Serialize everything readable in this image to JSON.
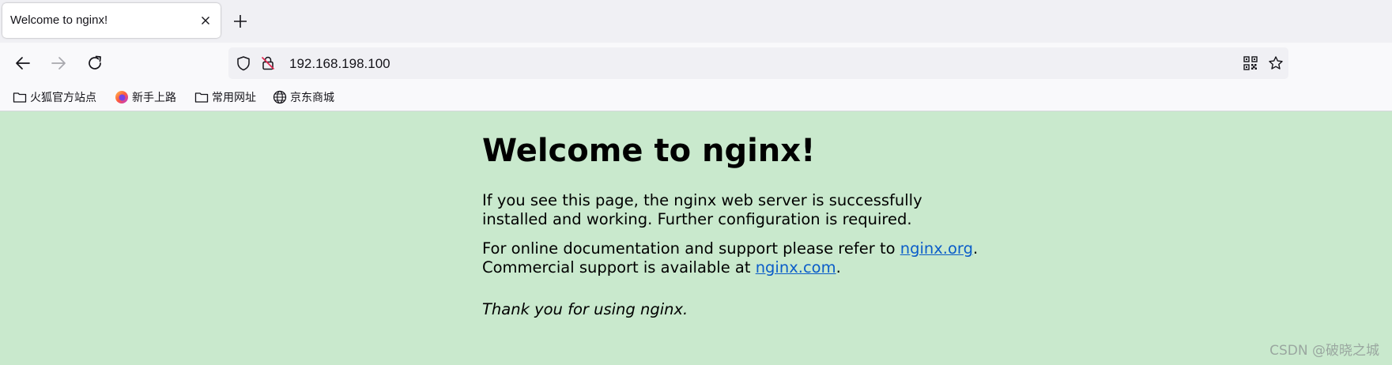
{
  "tab": {
    "title": "Welcome to nginx!",
    "close_icon": "close-icon",
    "new_tab_icon": "plus-icon"
  },
  "toolbar": {
    "back_icon": "arrow-left-icon",
    "forward_icon": "arrow-right-icon",
    "reload_icon": "reload-icon",
    "url": "192.168.198.100",
    "security_icon": "shield-icon",
    "insecure_icon": "insecure-lock-icon",
    "qr_icon": "qr-code-icon",
    "bookmark_star_icon": "star-icon"
  },
  "bookmarks": [
    {
      "label": "火狐官方站点",
      "icon": "folder-icon"
    },
    {
      "label": "新手上路",
      "icon": "firefox-icon"
    },
    {
      "label": "常用网址",
      "icon": "folder-icon"
    },
    {
      "label": "京东商城",
      "icon": "globe-icon"
    }
  ],
  "content": {
    "heading": "Welcome to nginx!",
    "para1": "If you see this page, the nginx web server is successfully installed and working. Further configuration is required.",
    "para2_prefix": "For online documentation and support please refer to ",
    "link1": "nginx.org",
    "para2_mid": ".",
    "para2_line2": "Commercial support is available at ",
    "link2": "nginx.com",
    "para2_end": ".",
    "para3": "Thank you for using nginx."
  },
  "watermark": "CSDN @破晓之城",
  "colors": {
    "page_background": "#c9e9cd",
    "link": "#0b5dc9",
    "chrome": "#f9f9fb"
  }
}
